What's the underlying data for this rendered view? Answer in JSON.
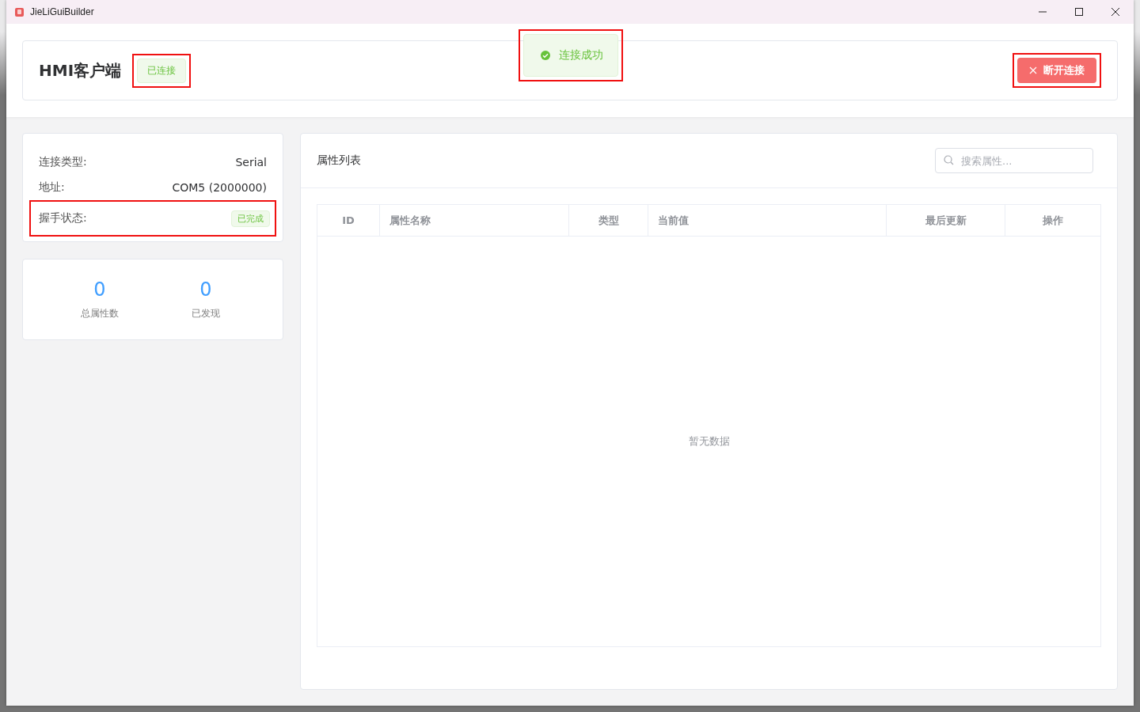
{
  "window": {
    "title": "JieLiGuiBuilder"
  },
  "header": {
    "title": "HMI客户端",
    "status": {
      "label": "已连接",
      "highlighted": true
    },
    "disconnect_button": {
      "label": "断开连接",
      "highlighted": true
    }
  },
  "toast": {
    "message": "连接成功",
    "kind": "success",
    "highlighted": true
  },
  "connection_info": [
    {
      "label": "连接类型:",
      "value": "Serial",
      "kind": "text",
      "highlighted": false
    },
    {
      "label": "地址:",
      "value": "COM5 (2000000)",
      "kind": "text",
      "highlighted": false
    },
    {
      "label": "握手状态:",
      "value": "已完成",
      "kind": "tag",
      "highlighted": true
    }
  ],
  "stats": [
    {
      "value": "0",
      "label": "总属性数"
    },
    {
      "value": "0",
      "label": "已发现"
    }
  ],
  "property_panel": {
    "title": "属性列表",
    "search": {
      "placeholder": "搜索属性..."
    },
    "table": {
      "columns": [
        {
          "label": "ID"
        },
        {
          "label": "属性名称"
        },
        {
          "label": "类型"
        },
        {
          "label": "当前值"
        },
        {
          "label": "最后更新"
        },
        {
          "label": "操作"
        }
      ],
      "empty_text": "暂无数据"
    }
  }
}
